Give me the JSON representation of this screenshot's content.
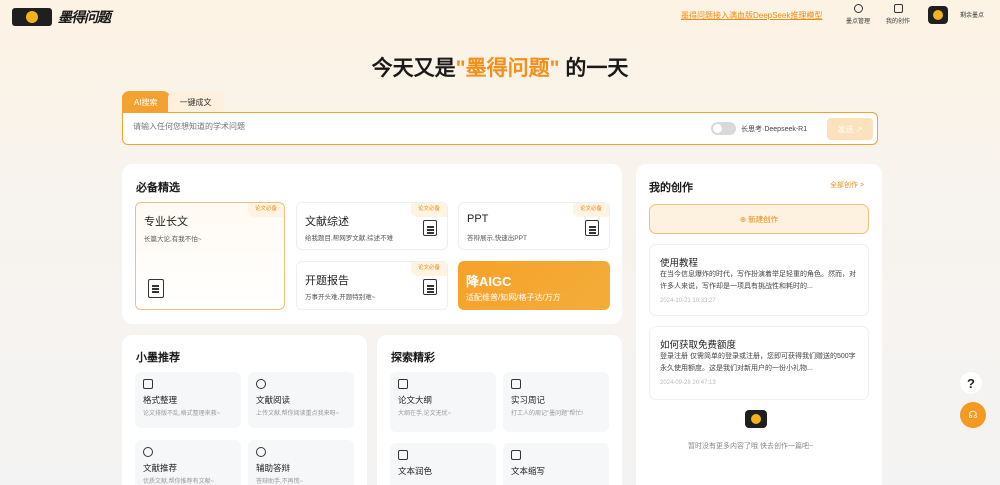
{
  "header": {
    "logo_text": "墨得问题",
    "notice": "墨得问题接入满血版DeepSeek推理模型",
    "nav": [
      {
        "label": "墨点管理",
        "icon": "settings-icon"
      },
      {
        "label": "我的创作",
        "icon": "document-icon"
      }
    ],
    "remain_label": "剩余墨点"
  },
  "hero": {
    "prefix": "今天又是",
    "highlight": "\"墨得问题\"",
    "suffix": " 的一天"
  },
  "search": {
    "tabs": [
      "AI搜索",
      "一键成文"
    ],
    "placeholder": "请输入任何您想知道的学术问题",
    "deep_label": "长思考·Deepseek-R1",
    "send_label": "发送 ↗"
  },
  "essentials": {
    "title": "必备精选",
    "items": [
      {
        "title": "专业长文",
        "sub": "长篇大论,有我不怕~",
        "badge": "论文必备"
      },
      {
        "title": "文献综述",
        "sub": "给我题目,帮网罗文献,综述不难",
        "badge": "论文必备"
      },
      {
        "title": "PPT",
        "sub": "答辩展示,快速出PPT",
        "badge": "论文必备"
      },
      {
        "title": "开题报告",
        "sub": "万事开头难,开题特别难~",
        "badge": "论文必备"
      },
      {
        "title": "降AIGC",
        "sub": "适配维普/知网/格子达/万方"
      }
    ]
  },
  "recommend": {
    "title": "小墨推荐",
    "items": [
      {
        "title": "格式整理",
        "sub": "论文排版不乱,格式整理来救~"
      },
      {
        "title": "文献阅读",
        "sub": "上传文献,帮你阅读重点我来呀~"
      },
      {
        "title": "文献推荐",
        "sub": "优质文献,帮你推荐有文献~"
      },
      {
        "title": "辅助答辩",
        "sub": "答辩助手,不再慌~"
      }
    ]
  },
  "explore": {
    "title": "探索精彩",
    "items": [
      {
        "title": "论文大纲",
        "sub": "大纲在手,论文无忧~"
      },
      {
        "title": "实习周记",
        "sub": "打工人的周记\"墨问题\"帮忙!"
      },
      {
        "title": "文本润色",
        "sub": ""
      },
      {
        "title": "文本缩写",
        "sub": ""
      }
    ]
  },
  "creations": {
    "title": "我的创作",
    "all_link": "全部创作 >",
    "new_label": "⊕ 新建创作",
    "cards": [
      {
        "title": "使用教程",
        "desc": "在当今信息爆炸的时代，写作扮演着举足轻重的角色。然而，对许多人来说，写作却是一项具有挑战性和耗时的...",
        "date": "2024-10-21 10:33:27"
      },
      {
        "title": "如何获取免费额度",
        "desc": "登录注册 仅需简单的登录或注册，您即可获得我们赠送的500字永久使用额度。这是我们对新用户的一份小礼物...",
        "date": "2024-09-28 20:47:13"
      }
    ],
    "empty_note": "暂时没有更多内容了哦 快去创作一篇吧~"
  },
  "float": {
    "help": "?",
    "service": "☊"
  }
}
